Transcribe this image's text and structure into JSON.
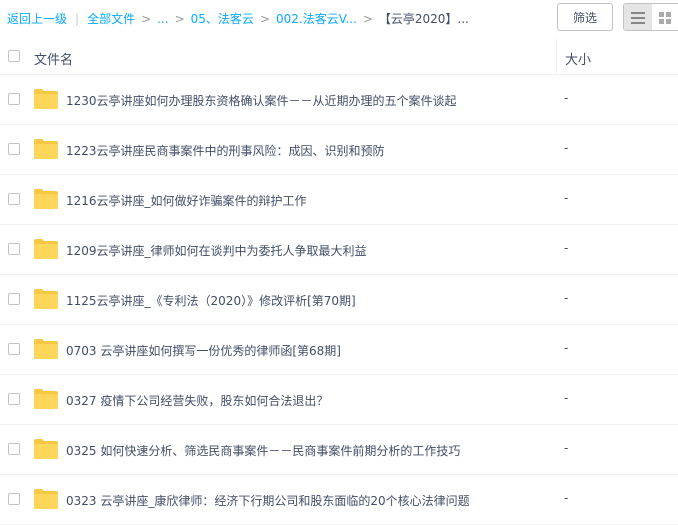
{
  "breadcrumb": {
    "back": "返回上一级",
    "divider": "|",
    "root": "全部文件",
    "ellipsis": "...",
    "level1": "05、法客云",
    "level2": "002.法客云V...",
    "current": "【云亭2020】...",
    "arrow": ">"
  },
  "toolbar": {
    "filter_label": "筛选",
    "view_list_icon": "list-view-icon",
    "view_grid_icon": "grid-view-icon"
  },
  "table": {
    "headers": {
      "name": "文件名",
      "size": "大小"
    },
    "rows": [
      {
        "name": "1230云亭讲座如何办理股东资格确认案件－－从近期办理的五个案件谈起",
        "size": "-"
      },
      {
        "name": "1223云亭讲座民商事案件中的刑事风险：成因、识别和预防",
        "size": "-"
      },
      {
        "name": "1216云亭讲座_如何做好诈骗案件的辩护工作",
        "size": "-"
      },
      {
        "name": "1209云亭讲座_律师如何在谈判中为委托人争取最大利益",
        "size": "-"
      },
      {
        "name": "1125云亭讲座_《专利法（2020）》修改评析[第70期]",
        "size": "-"
      },
      {
        "name": "0703 云亭讲座如何撰写一份优秀的律师函[第68期]",
        "size": "-"
      },
      {
        "name": "0327 疫情下公司经营失败，股东如何合法退出？",
        "size": "-"
      },
      {
        "name": "0325 如何快速分析、筛选民商事案件－－民商事案件前期分析的工作技巧",
        "size": "-"
      },
      {
        "name": "0323 云亭讲座_康欣律师：经济下行期公司和股东面临的20个核心法律问题",
        "size": "-"
      }
    ]
  },
  "colors": {
    "link": "#09aaff",
    "text": "#424e67",
    "folder": "#ffd659",
    "folder_tab": "#f7c746"
  }
}
